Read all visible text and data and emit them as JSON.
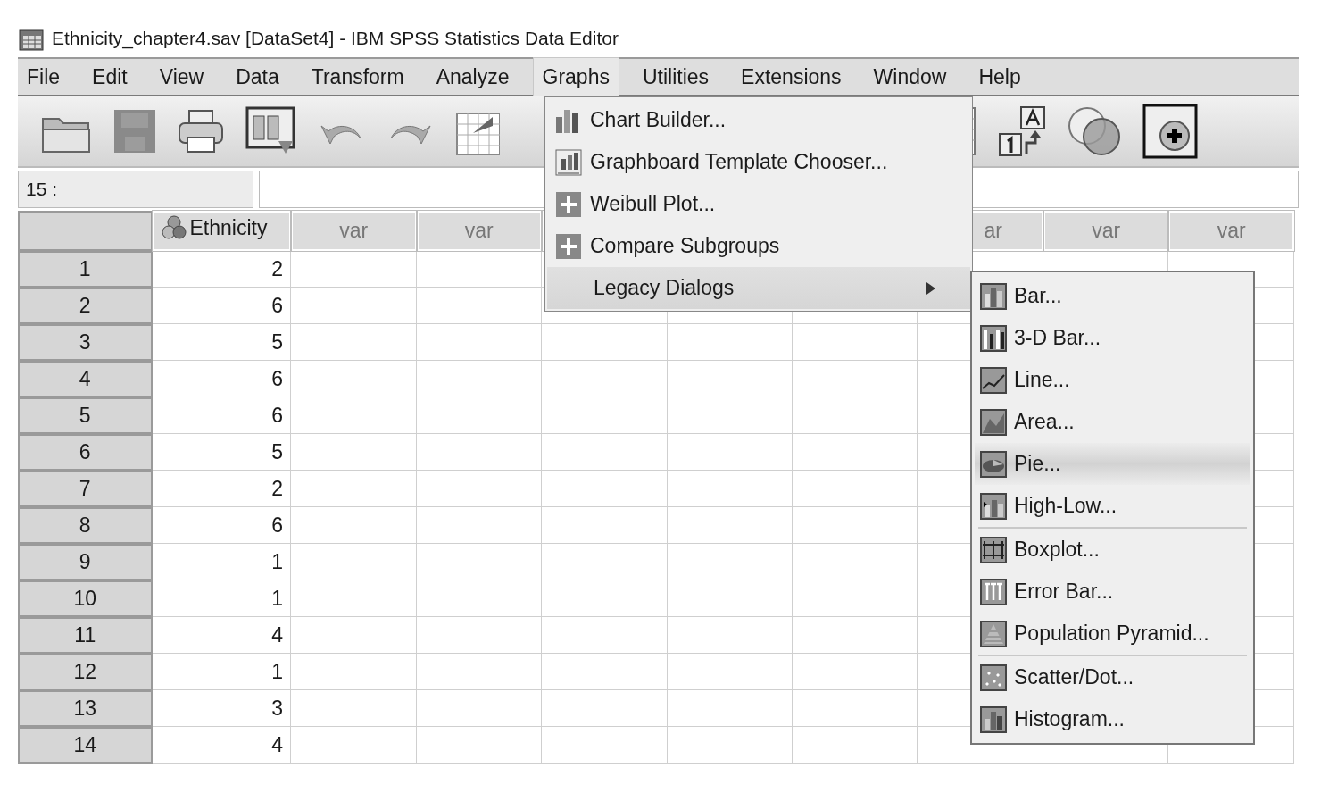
{
  "window": {
    "title": "Ethnicity_chapter4.sav [DataSet4] - IBM SPSS Statistics Data Editor"
  },
  "menu_bar": [
    {
      "label": "File",
      "selected": false
    },
    {
      "label": "Edit",
      "selected": false
    },
    {
      "label": "View",
      "selected": false
    },
    {
      "label": "Data",
      "selected": false
    },
    {
      "label": "Transform",
      "selected": false
    },
    {
      "label": "Analyze",
      "selected": false
    },
    {
      "label": "Graphs",
      "selected": true
    },
    {
      "label": "Utilities",
      "selected": false
    },
    {
      "label": "Extensions",
      "selected": false
    },
    {
      "label": "Window",
      "selected": false
    },
    {
      "label": "Help",
      "selected": false
    }
  ],
  "cell_editor": {
    "reference": "15 :"
  },
  "grid": {
    "columns": [
      {
        "label": "Ethnicity",
        "kind": "variable"
      },
      {
        "label": "var",
        "kind": "empty"
      },
      {
        "label": "var",
        "kind": "empty"
      },
      {
        "kind": "hidden"
      },
      {
        "kind": "hidden"
      },
      {
        "kind": "hidden"
      },
      {
        "label": "ar",
        "kind": "empty"
      },
      {
        "label": "var",
        "kind": "empty"
      },
      {
        "label": "var",
        "kind": "empty"
      }
    ],
    "rows": [
      {
        "number": "1",
        "value": "2"
      },
      {
        "number": "2",
        "value": "6"
      },
      {
        "number": "3",
        "value": "5"
      },
      {
        "number": "4",
        "value": "6"
      },
      {
        "number": "5",
        "value": "6"
      },
      {
        "number": "6",
        "value": "5"
      },
      {
        "number": "7",
        "value": "2"
      },
      {
        "number": "8",
        "value": "6"
      },
      {
        "number": "9",
        "value": "1"
      },
      {
        "number": "10",
        "value": "1"
      },
      {
        "number": "11",
        "value": "4"
      },
      {
        "number": "12",
        "value": "1"
      },
      {
        "number": "13",
        "value": "3"
      },
      {
        "number": "14",
        "value": "4"
      }
    ]
  },
  "graphs_menu": [
    {
      "label": "Chart Builder...",
      "has_submenu": false,
      "selected": false
    },
    {
      "label": "Graphboard Template Chooser...",
      "has_submenu": false,
      "selected": false
    },
    {
      "label": "Weibull Plot...",
      "has_submenu": false,
      "selected": false
    },
    {
      "label": "Compare Subgroups",
      "has_submenu": false,
      "selected": false
    },
    {
      "label": "Legacy Dialogs",
      "has_submenu": true,
      "selected": true
    }
  ],
  "legacy_dialogs_menu": {
    "groups": [
      [
        {
          "label": "Bar...",
          "selected": false
        },
        {
          "label": "3-D Bar...",
          "selected": false
        },
        {
          "label": "Line...",
          "selected": false
        },
        {
          "label": "Area...",
          "selected": false
        },
        {
          "label": "Pie...",
          "selected": true
        },
        {
          "label": "High-Low...",
          "selected": false
        }
      ],
      [
        {
          "label": "Boxplot...",
          "selected": false
        },
        {
          "label": "Error Bar...",
          "selected": false
        },
        {
          "label": "Population Pyramid...",
          "selected": false
        }
      ],
      [
        {
          "label": "Scatter/Dot...",
          "selected": false
        },
        {
          "label": "Histogram...",
          "selected": false
        }
      ]
    ]
  }
}
